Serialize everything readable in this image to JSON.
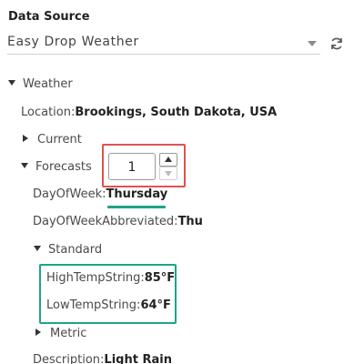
{
  "panel": {
    "title": "Data Source",
    "source_select": {
      "value": "Easy Drop Weather"
    }
  },
  "tree": {
    "weather": {
      "label": "Weather"
    },
    "location": {
      "key": "Location:",
      "value": "Brookings, South Dakota, USA"
    },
    "current": {
      "label": "Current"
    },
    "forecasts": {
      "label": "Forecasts",
      "index_value": "1"
    },
    "day_of_week": {
      "key": "DayOfWeek:",
      "value": "Thursday"
    },
    "day_of_week_abbr": {
      "key": "DayOfWeekAbbreviated:",
      "value": "Thu"
    },
    "standard": {
      "label": "Standard"
    },
    "high_temp": {
      "key": "HighTempString:",
      "value": "85°F"
    },
    "low_temp": {
      "key": "LowTempString:",
      "value": "64°F"
    },
    "metric": {
      "label": "Metric"
    },
    "description": {
      "key": "Description:",
      "value": "Light Rain"
    }
  },
  "colors": {
    "highlight_red": "#e0524f",
    "highlight_green": "#1fa38a"
  },
  "icons": {
    "refresh": "refresh-icon",
    "expanded": "caret-down-icon",
    "collapsed": "caret-right-icon"
  }
}
